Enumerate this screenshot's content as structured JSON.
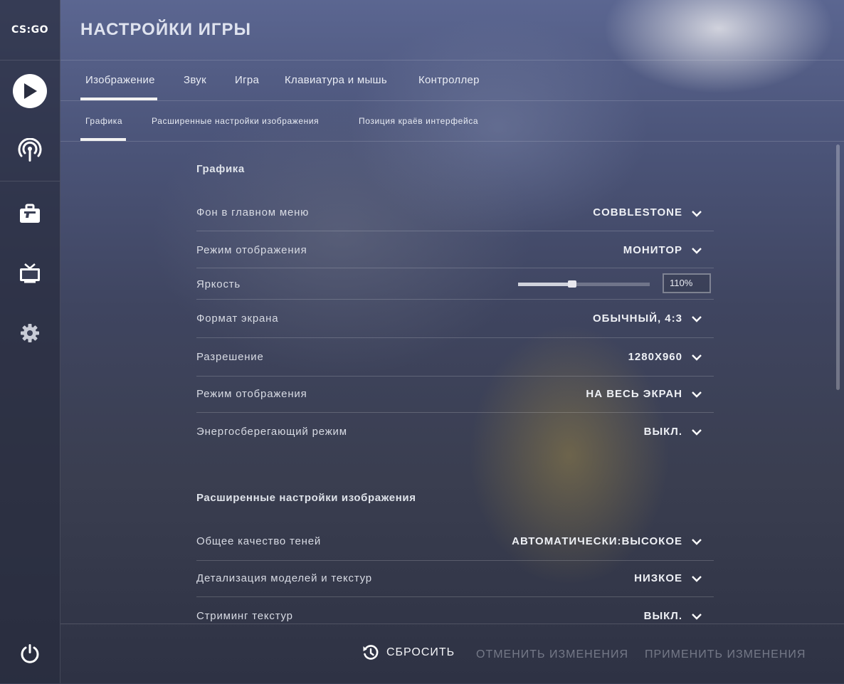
{
  "logo": "CS:GO",
  "page_title": "НАСТРОЙКИ ИГРЫ",
  "sidebar": {
    "items": [
      {
        "icon": "play-icon"
      },
      {
        "icon": "broadcast-icon"
      },
      {
        "icon": "inventory-briefcase-icon"
      },
      {
        "icon": "tv-watch-icon"
      },
      {
        "icon": "gear-icon"
      },
      {
        "icon": "power-icon"
      }
    ]
  },
  "tabs": [
    {
      "label": "Изображение",
      "active": true
    },
    {
      "label": "Звук"
    },
    {
      "label": "Игра"
    },
    {
      "label": "Клавиатура и мышь"
    },
    {
      "label": "Контроллер"
    }
  ],
  "subtabs": [
    {
      "label": "Графика",
      "active": true
    },
    {
      "label": "Расширенные настройки изображения"
    },
    {
      "label": "Позиция краёв интерфейса"
    }
  ],
  "sections": [
    {
      "title": "Графика",
      "rows": [
        {
          "label": "Фон в главном меню",
          "value": "COBBLESTONE"
        },
        {
          "label": "Режим отображения",
          "value": "МОНИТОР"
        },
        {
          "label": "Яркость",
          "value": "110%",
          "slider_fraction": 0.41
        },
        {
          "label": "Формат экрана",
          "value": "ОБЫЧНЫЙ, 4:3"
        },
        {
          "label": "Разрешение",
          "value": "1280X960"
        },
        {
          "label": "Режим отображения",
          "value": "НА ВЕСЬ ЭКРАН"
        },
        {
          "label": "Энергосберегающий режим",
          "value": "ВЫКЛ."
        }
      ]
    },
    {
      "title": "Расширенные настройки изображения",
      "rows": [
        {
          "label": "Общее качество теней",
          "value": "АВТОМАТИЧЕСКИ:ВЫСОКОЕ"
        },
        {
          "label": "Детализация моделей и текстур",
          "value": "НИЗКОЕ"
        },
        {
          "label": "Стриминг текстур",
          "value": "ВЫКЛ."
        }
      ]
    }
  ],
  "footer": {
    "reset_label": "СБРОСИТЬ",
    "cancel_label": "ОТМЕНИТЬ ИЗМЕНЕНИЯ",
    "apply_label": "ПРИМЕНИТЬ ИЗМЕНЕНИЯ"
  },
  "colors": {
    "accent": "#f2f2f2",
    "disabled_text": "#8f94a3"
  }
}
